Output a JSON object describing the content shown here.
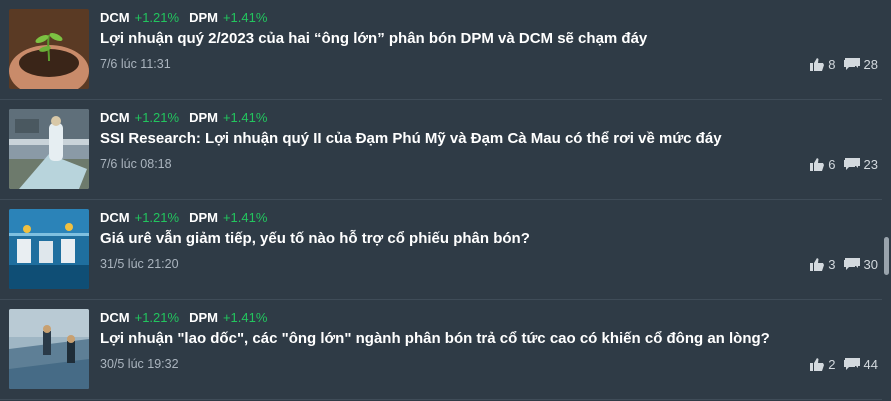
{
  "articles": [
    {
      "tickers": [
        {
          "symbol": "DCM",
          "change": "+1.21%"
        },
        {
          "symbol": "DPM",
          "change": "+1.41%"
        }
      ],
      "title": "Lợi nhuận quý 2/2023 của hai “ông lớn” phân bón DPM và DCM sẽ chạm đáy",
      "time": "7/6 lúc 11:31",
      "likes": "8",
      "comments": "28",
      "thumbnail": "seedling-in-hands"
    },
    {
      "tickers": [
        {
          "symbol": "DCM",
          "change": "+1.21%"
        },
        {
          "symbol": "DPM",
          "change": "+1.41%"
        }
      ],
      "title": "SSI Research: Lợi nhuận quý II của Đạm Phú Mỹ và Đạm Cà Mau có thể rơi về mức đáy",
      "time": "7/6 lúc 08:18",
      "likes": "6",
      "comments": "23",
      "thumbnail": "fertilizer-factory-worker"
    },
    {
      "tickers": [
        {
          "symbol": "DCM",
          "change": "+1.21%"
        },
        {
          "symbol": "DPM",
          "change": "+1.41%"
        }
      ],
      "title": "Giá urê vẫn giảm tiếp, yếu tố nào hỗ trợ cổ phiếu phân bón?",
      "time": "31/5 lúc 21:20",
      "likes": "3",
      "comments": "30",
      "thumbnail": "fertilizer-bagging-line"
    },
    {
      "tickers": [
        {
          "symbol": "DCM",
          "change": "+1.21%"
        },
        {
          "symbol": "DPM",
          "change": "+1.41%"
        }
      ],
      "title": "Lợi nhuận \"lao dốc\", các \"ông lớn\" ngành phân bón trả cổ tức cao có khiến cổ đông an lòng?",
      "time": "30/5 lúc 19:32",
      "likes": "2",
      "comments": "44",
      "thumbnail": "fertilizer-warehouse-workers"
    }
  ],
  "colors": {
    "background": "#2f3b46",
    "positive": "#22c55e",
    "muted": "#aab4be"
  },
  "icons": {
    "likes": "thumbs-up-icon",
    "comments": "comment-icon"
  }
}
